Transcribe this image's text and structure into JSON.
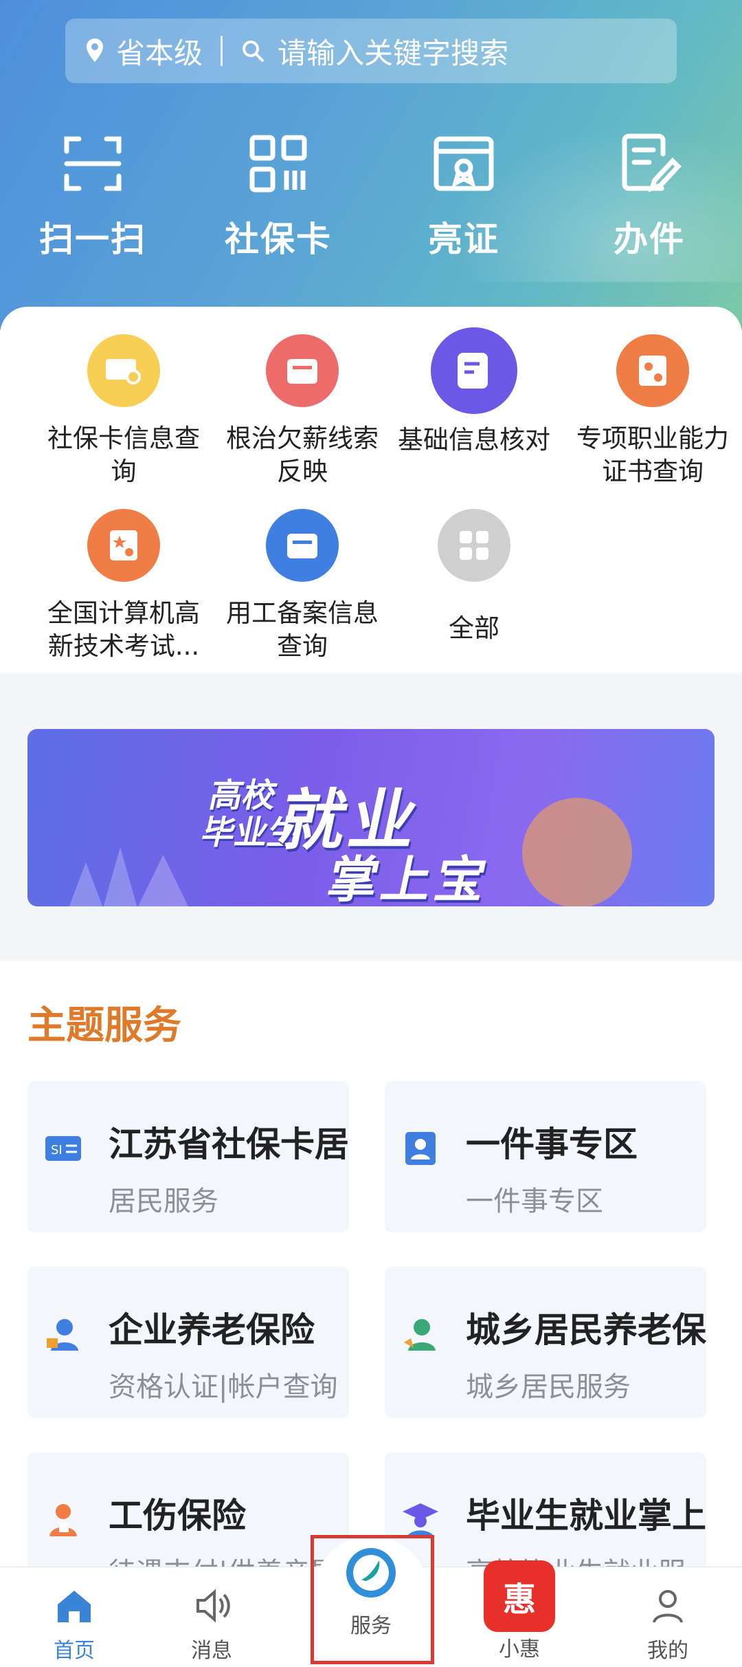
{
  "header": {
    "location": "省本级",
    "search_placeholder": "请输入关键字搜索"
  },
  "quick_actions": [
    "扫一扫",
    "社保卡",
    "亮证",
    "办件"
  ],
  "services": [
    {
      "label": "社保卡信息查询",
      "icon": "card-search-icon",
      "color": "#f5c542"
    },
    {
      "label": "根治欠薪线索反映",
      "icon": "inbox-icon",
      "color": "#ef6a6a"
    },
    {
      "label": "基础信息核对",
      "icon": "edit-form-icon",
      "color": "#6f5ce8"
    },
    {
      "label": "专项职业能力证书查询",
      "icon": "certificate-icon",
      "color": "#ef7d45"
    },
    {
      "label": "全国计算机高新技术考试...",
      "icon": "certificate-star-icon",
      "color": "#ef7d45"
    },
    {
      "label": "用工备案信息查询",
      "icon": "inbox-icon",
      "color": "#3f7fe0"
    },
    {
      "label": "全部",
      "icon": "grid-icon",
      "color": "#c8c8c8"
    }
  ],
  "banner": {
    "line_small": "高校\n毕业生",
    "line_big": "就业",
    "line_bottom": "掌上宝"
  },
  "theme": {
    "title": "主题服务",
    "cards": [
      {
        "title": "江苏省社保卡居",
        "subtitle": "居民服务",
        "icon": "si-card-icon"
      },
      {
        "title": "一件事专区",
        "subtitle": "一件事专区",
        "icon": "person-book-icon"
      },
      {
        "title": "企业养老保险",
        "subtitle": "资格认证|帐户查询",
        "icon": "worker-icon"
      },
      {
        "title": "城乡居民养老保",
        "subtitle": "城乡居民服务",
        "icon": "farmer-icon"
      },
      {
        "title": "工伤保险",
        "subtitle": "待遇支付|供养亲属",
        "icon": "injured-worker-icon"
      },
      {
        "title": "毕业生就业掌上",
        "subtitle": "高校毕业生就业服",
        "icon": "graduate-icon"
      }
    ]
  },
  "tabs": [
    {
      "label": "首页",
      "icon": "home-icon"
    },
    {
      "label": "消息",
      "icon": "speaker-icon"
    },
    {
      "label": "服务",
      "icon": "service-logo-icon"
    },
    {
      "label": "小惠",
      "icon": "xiaohui-icon"
    },
    {
      "label": "我的",
      "icon": "person-icon"
    }
  ],
  "colors": {
    "accent": "#3a84d8",
    "theme_title": "#e07a2b",
    "highlight": "#d93a33"
  }
}
